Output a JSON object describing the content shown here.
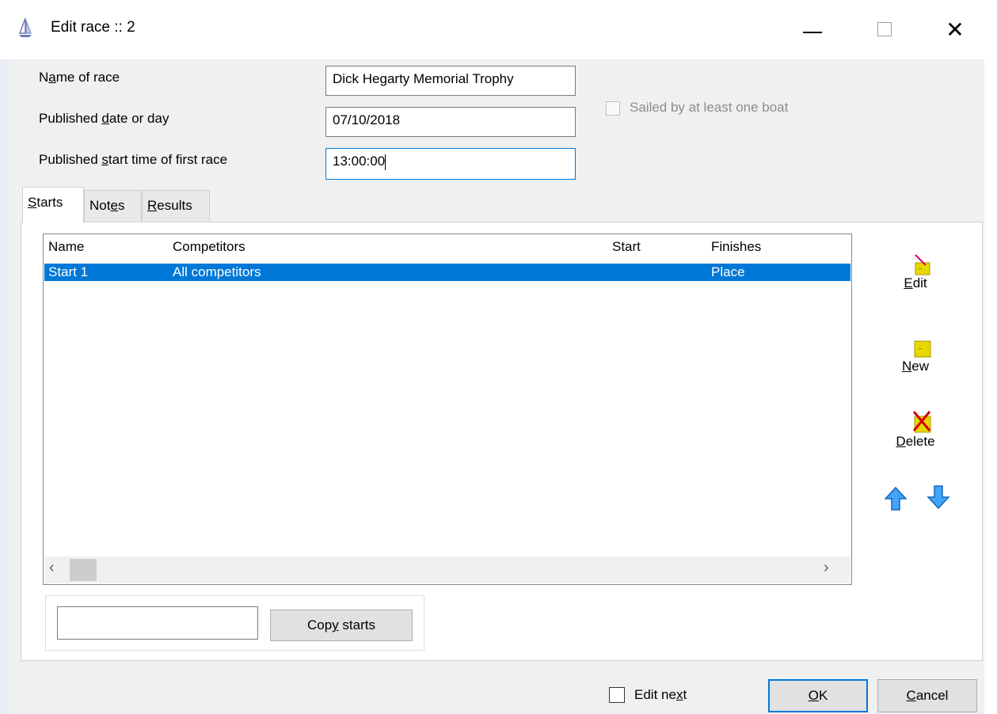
{
  "window": {
    "title": "Edit race :: 2",
    "close_glyph": "✕"
  },
  "form": {
    "name_label_pre": "N",
    "name_label_u": "a",
    "name_label_post": "me of race",
    "name_value": "Dick Hegarty Memorial Trophy",
    "date_label_pre": "Published ",
    "date_label_u": "d",
    "date_label_post": "ate or day",
    "date_value": "07/10/2018",
    "time_label_pre": "Published ",
    "time_label_u": "s",
    "time_label_post": "tart time of first race",
    "time_value": "13:00:00",
    "sailed_label": "Sailed by at least one boat"
  },
  "tabs": [
    {
      "u": "S",
      "rest": "tarts"
    },
    {
      "pre": "Not",
      "u": "e",
      "rest": "s"
    },
    {
      "u": "R",
      "rest": "esults"
    }
  ],
  "list": {
    "columns": [
      "Name",
      "Competitors",
      "Start",
      "Finishes"
    ],
    "rows": [
      {
        "name": "Start 1",
        "competitors": "All competitors",
        "start": "",
        "finishes": "Place"
      }
    ],
    "scroll_left": "‹",
    "scroll_right": "›"
  },
  "side_buttons": {
    "edit_u": "E",
    "edit_rest": "dit",
    "new_u": "N",
    "new_rest": "ew",
    "delete_u": "D",
    "delete_rest": "elete"
  },
  "copy": {
    "input_value": "",
    "button_pre": "Cop",
    "button_u": "y",
    "button_post": " starts"
  },
  "bottom": {
    "edit_next_pre": "Edit ne",
    "edit_next_u": "x",
    "edit_next_post": "t",
    "ok_u": "O",
    "ok_rest": "K",
    "cancel_u": "C",
    "cancel_rest": "ancel"
  },
  "colors": {
    "selection": "#0078d7",
    "icon_yellow": "#e8d800",
    "arrow_blue": "#1e88e5"
  }
}
